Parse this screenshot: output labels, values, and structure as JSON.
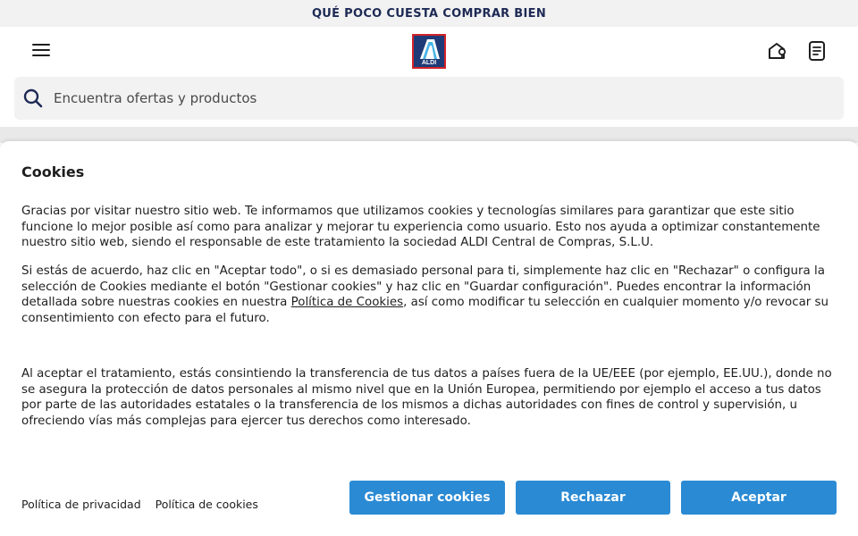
{
  "promo": {
    "text": "QUÉ POCO CUESTA COMPRAR BIEN"
  },
  "header": {
    "menu_icon": "hamburger-menu-icon",
    "logo_text": "ALDI",
    "store_icon": "store-locator-icon",
    "list_icon": "shopping-list-icon"
  },
  "search": {
    "placeholder": "Encuentra ofertas y productos",
    "icon": "search-icon"
  },
  "cookies": {
    "title": "Cookies",
    "p1": "Gracias por visitar nuestro sitio web. Te informamos que utilizamos cookies y tecnologías similares para garantizar que este sitio funcione lo mejor posible así como para analizar y mejorar tu experiencia como usuario. Esto nos ayuda a optimizar constantemente nuestro sitio web, siendo el responsable de este tratamiento la sociedad ALDI Central de Compras, S.L.U.",
    "p2_before": "Si estás de acuerdo, haz clic en \"Aceptar todo\", o si es demasiado personal para ti, simplemente haz clic en \"Rechazar\" o configura la selección de Cookies mediante el botón \"Gestionar cookies\" y haz clic en \"Guardar configuración\". Puedes encontrar la información detallada sobre nuestras cookies en nuestra ",
    "p2_link": "Política de Cookies",
    "p2_after": ", así como modificar tu selección en cualquier momento y/o revocar su consentimiento con efecto para el futuro.",
    "p3": "Al aceptar el tratamiento, estás consintiendo la transferencia de tus datos a países fuera de la UE/EEE (por ejemplo, EE.UU.), donde no se asegura la protección de datos personales al mismo nivel que en la Unión Europea, permitiendo por ejemplo el acceso a tus datos por parte de las autoridades estatales o la transferencia de los mismos a dichas autoridades con fines de control y supervisión, u ofreciendo vías más complejas para ejercer tus derechos como interesado.",
    "privacy_link": "Política de privacidad",
    "cookies_link": "Política de cookies",
    "manage_label": "Gestionar cookies",
    "reject_label": "Rechazar",
    "accept_label": "Aceptar"
  },
  "colors": {
    "accent": "#2a8ad4",
    "brand_blue": "#1f3b77",
    "brand_red": "#d2232a",
    "promo_text": "#1e2a55"
  }
}
